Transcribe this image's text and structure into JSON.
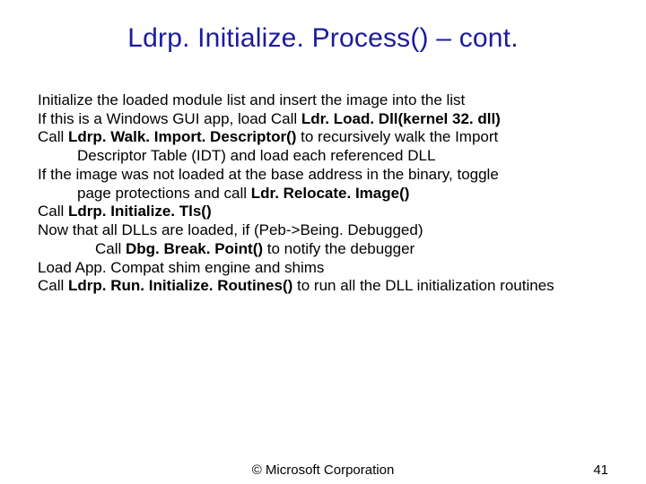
{
  "title": "Ldrp. Initialize. Process() – cont.",
  "body": {
    "p1": "Initialize the loaded module list and insert the image into the list",
    "p2_a": "If this is a Windows GUI app, load Call ",
    "p2_b": "Ldr. Load. Dll(kernel 32. dll)",
    "p3_a": "Call ",
    "p3_b": "Ldrp. Walk. Import. Descriptor()",
    "p3_c": " to recursively walk the Import",
    "p3_indent": "Descriptor Table (IDT) and load each referenced DLL",
    "p4": "If the image was not loaded at the base address in the binary, toggle",
    "p4_indent_a": "page protections and call ",
    "p4_indent_b": "Ldr. Relocate. Image()",
    "p5_a": "Call ",
    "p5_b": "Ldrp. Initialize. Tls()",
    "p6": "Now that all DLLs are loaded, if (Peb->Being. Debugged)",
    "p6_indent_a": "Call ",
    "p6_indent_b": "Dbg. Break. Point()",
    "p6_indent_c": " to notify the debugger",
    "p7": "Load App. Compat shim engine and shims",
    "p8_a": "Call ",
    "p8_b": "Ldrp. Run. Initialize. Routines()",
    "p8_c": " to run all the DLL initialization routines"
  },
  "footer": {
    "copyright": "© Microsoft Corporation",
    "page": "41"
  }
}
